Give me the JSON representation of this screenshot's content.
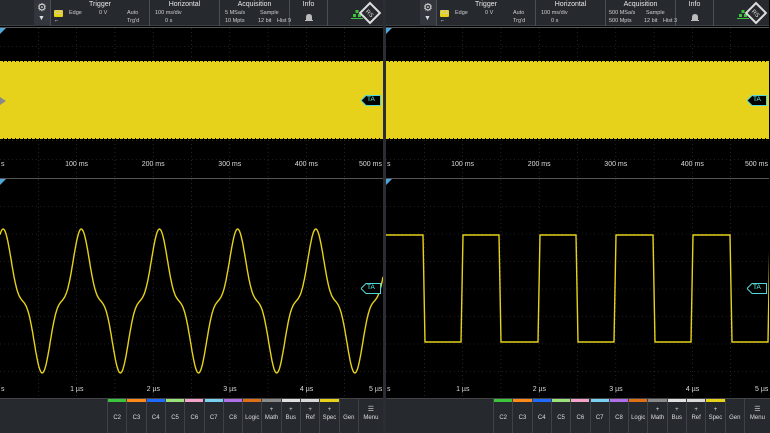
{
  "panels": [
    {
      "toolbar": {
        "channel_badge": "C1",
        "trigger": {
          "header": "Trigger",
          "type": "Edge",
          "level": "0 V",
          "mode": "Auto",
          "status": "Trg'd"
        },
        "horizontal": {
          "header": "Horizontal",
          "scale": "100 ms/div",
          "position": "0 s"
        },
        "acquisition": {
          "header": "Acquisition",
          "sample_rate": "5 MSa/s",
          "record_length": "10 Mpts",
          "mode": "Sample",
          "bits": "12 bit",
          "history": "Hist 9"
        },
        "info": {
          "header": "Info"
        }
      },
      "upper_axis": [
        "s",
        "100 ms",
        "200 ms",
        "300 ms",
        "400 ms",
        "500 ms"
      ],
      "lower_axis": [
        "s",
        "1 µs",
        "2 µs",
        "3 µs",
        "4 µs",
        "5 µs"
      ],
      "upper_marker": "TA",
      "lower_marker": "TA",
      "waveform": "sine_distorted"
    },
    {
      "toolbar": {
        "channel_badge": "C1",
        "trigger": {
          "header": "Trigger",
          "type": "Edge",
          "level": "0 V",
          "mode": "Auto",
          "status": "Trg'd"
        },
        "horizontal": {
          "header": "Horizontal",
          "scale": "100 ms/div",
          "position": "0 s"
        },
        "acquisition": {
          "header": "Acquisition",
          "sample_rate": "500 MSa/s",
          "record_length": "500 Mpts",
          "mode": "Sample",
          "bits": "12 bit",
          "history": "Hist 3"
        },
        "info": {
          "header": "Info"
        }
      },
      "upper_axis": [
        "s",
        "100 ms",
        "200 ms",
        "300 ms",
        "400 ms",
        "500 ms"
      ],
      "lower_axis": [
        "s",
        "1 µs",
        "2 µs",
        "3 µs",
        "4 µs",
        "5 µs"
      ],
      "upper_marker": "TA",
      "lower_marker": "TA",
      "waveform": "square"
    }
  ],
  "bottombar": {
    "channels": [
      {
        "label": "C2",
        "color": "#3cc43c"
      },
      {
        "label": "C3",
        "color": "#ff8a1a"
      },
      {
        "label": "C4",
        "color": "#1f6bff"
      },
      {
        "label": "C5",
        "color": "#9be27a"
      },
      {
        "label": "C6",
        "color": "#f5a3c8"
      },
      {
        "label": "C7",
        "color": "#7ad0f0"
      },
      {
        "label": "C8",
        "color": "#b070e8"
      },
      {
        "label": "Logic",
        "color": "#e07018"
      }
    ],
    "tools": [
      {
        "label": "Math",
        "plus": "+",
        "color": "#8a8a8a"
      },
      {
        "label": "Bus",
        "plus": "+",
        "color": "#e0e0e0"
      },
      {
        "label": "Ref",
        "plus": "+",
        "color": "#d8d8d8"
      },
      {
        "label": "Spec",
        "plus": "+",
        "color": "#e6d21a"
      },
      {
        "label": "Gen",
        "plus": "",
        "color": ""
      }
    ],
    "menu_label": "Menu"
  },
  "colors": {
    "trace": "#e6d21a",
    "grid": "#3d3d3d",
    "marker": "#4fd8d8",
    "trigger_marker": "#4fa8d8"
  }
}
